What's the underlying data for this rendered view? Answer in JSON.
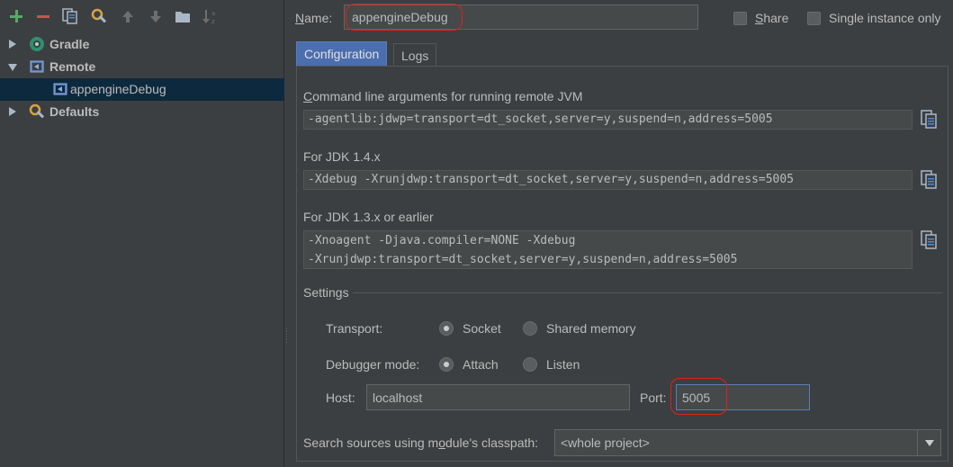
{
  "toolbar": {
    "icons": [
      "add-icon",
      "remove-icon",
      "copy-icon",
      "wrench-icon",
      "move-up-icon",
      "move-down-icon",
      "folder-icon",
      "sort-alpha-icon"
    ]
  },
  "tree": {
    "items": [
      {
        "label": "Gradle",
        "expanded": false,
        "icon": "gradle-icon",
        "bold": true
      },
      {
        "label": "Remote",
        "expanded": true,
        "icon": "remote-icon",
        "bold": true
      },
      {
        "label": "appengineDebug",
        "icon": "remote-config-icon",
        "selected": true
      },
      {
        "label": "Defaults",
        "expanded": false,
        "icon": "defaults-wrench-icon",
        "bold": true
      }
    ]
  },
  "header": {
    "name_label": "Name:",
    "name_value": "appengineDebug",
    "share_label": "Share",
    "share_checked": false,
    "single_instance_label": "Single instance only",
    "single_instance_checked": false
  },
  "tabs": [
    {
      "label": "Configuration",
      "active": true
    },
    {
      "label": "Logs",
      "active": false
    }
  ],
  "config": {
    "cmd_label": "Command line arguments for running remote JVM",
    "cmd_value": "-agentlib:jdwp=transport=dt_socket,server=y,suspend=n,address=5005",
    "jdk14_label": "For JDK 1.4.x",
    "jdk14_value": "-Xdebug -Xrunjdwp:transport=dt_socket,server=y,suspend=n,address=5005",
    "jdk13_label": "For JDK 1.3.x or earlier",
    "jdk13_line1": "-Xnoagent -Djava.compiler=NONE -Xdebug",
    "jdk13_line2": "-Xrunjdwp:transport=dt_socket,server=y,suspend=n,address=5005",
    "settings_label": "Settings",
    "transport_label": "Transport:",
    "transport_options": [
      "Socket",
      "Shared memory"
    ],
    "transport_selected": "Socket",
    "debugger_mode_label": "Debugger mode:",
    "debugger_mode_options": [
      "Attach",
      "Listen"
    ],
    "debugger_mode_selected": "Attach",
    "host_label": "Host:",
    "host_value": "localhost",
    "port_label": "Port:",
    "port_value": "5005",
    "module_label": "Search sources using module's classpath:",
    "module_value": "<whole project>"
  },
  "colors": {
    "background": "#3c3f41",
    "selection": "#0d293e",
    "active_tab": "#4b6eaf",
    "annotation_red": "#e0201b",
    "add_green": "#59a869",
    "remove_red": "#c75450"
  }
}
